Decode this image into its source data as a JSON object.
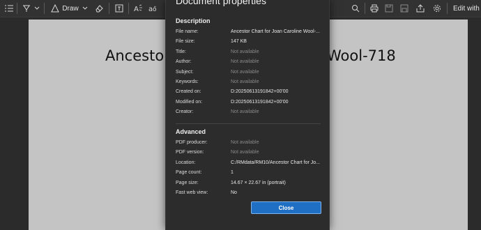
{
  "toolbar": {
    "draw_label": "Draw",
    "edit_label": "Edit with A"
  },
  "document": {
    "title_left": "Ancestor",
    "title_right": "Wool-718"
  },
  "dialog": {
    "title": "Document properties",
    "description_heading": "Description",
    "description_rows": [
      {
        "label": "File name:",
        "value": "Ancestor Chart for Joan Caroline Wool-...",
        "available": true
      },
      {
        "label": "File size:",
        "value": "147 KB",
        "available": true
      },
      {
        "label": "Title:",
        "value": "Not available",
        "available": false
      },
      {
        "label": "Author:",
        "value": "Not available",
        "available": false
      },
      {
        "label": "Subject:",
        "value": "Not available",
        "available": false
      },
      {
        "label": "Keywords:",
        "value": "Not available",
        "available": false
      },
      {
        "label": "Created on:",
        "value": "D:20250613191842+00'00",
        "available": true
      },
      {
        "label": "Modified on:",
        "value": "D:20250613191842+00'00",
        "available": true
      },
      {
        "label": "Creator:",
        "value": "Not available",
        "available": false
      }
    ],
    "advanced_heading": "Advanced",
    "advanced_rows": [
      {
        "label": "PDF producer:",
        "value": "Not available",
        "available": false
      },
      {
        "label": "PDF version:",
        "value": "Not available",
        "available": false
      },
      {
        "label": "Location:",
        "value": "C:/RMdata/RM10/Ancestor Chart for Jo...",
        "available": true
      },
      {
        "label": "Page count:",
        "value": "1",
        "available": true
      },
      {
        "label": "Page size:",
        "value": "14.67 × 22.67 in (portrait)",
        "available": true
      },
      {
        "label": "Fast web view:",
        "value": "No",
        "available": true
      }
    ],
    "close_label": "Close"
  },
  "colors": {
    "accent": "#1f6fc5",
    "dialog_bg": "#2c2c2c",
    "page_bg": "#c4c4c4",
    "unavailable_text": "#8a8a8a"
  },
  "icons": [
    "contents-icon",
    "highlight-icon",
    "chevron-down-icon",
    "draw-icon",
    "eraser-icon",
    "text-box-icon",
    "read-aloud-icon",
    "translate-icon",
    "search-icon",
    "print-icon",
    "save-icon",
    "save-as-icon",
    "share-icon",
    "settings-icon"
  ]
}
